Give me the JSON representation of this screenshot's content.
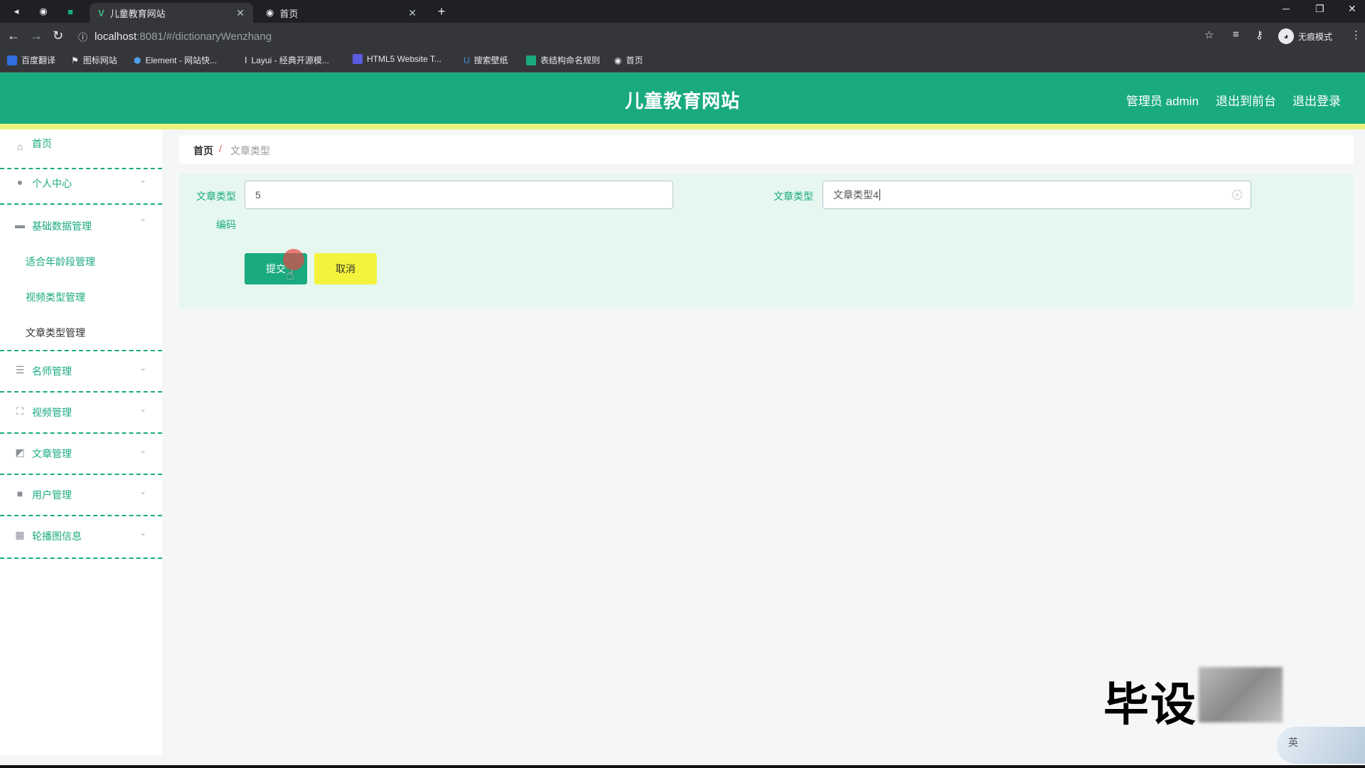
{
  "browser": {
    "tabs": [
      {
        "title": "儿童教育网站",
        "active": true
      },
      {
        "title": "首页",
        "active": false
      }
    ],
    "new_tab": "+",
    "url_host": "localhost",
    "url_path": ":8081/#/dictionaryWenzhang",
    "incognito_label": "无痕模式",
    "bookmarks": [
      {
        "label": "百度翻译",
        "color": "#2f6fe0"
      },
      {
        "label": "图标网站",
        "color": "#ffffff"
      },
      {
        "label": "Element - 网站快...",
        "color": "#4e9fe8"
      },
      {
        "label": "Layui - 经典开源模...",
        "color": "#cccccc"
      },
      {
        "label": "HTML5 Website T...",
        "color": "#5b5be0"
      },
      {
        "label": "搜索壁纸",
        "color": "#4a90e2"
      },
      {
        "label": "表结构命名规则",
        "color": "#1aaa80"
      },
      {
        "label": "首页",
        "color": "#dddddd"
      }
    ]
  },
  "header": {
    "title": "儿童教育网站",
    "admin_label": "管理员 admin",
    "to_front_label": "退出到前台",
    "logout_label": "退出登录"
  },
  "sidebar": {
    "home": "首页",
    "personal": "个人中心",
    "basic_data": "基础数据管理",
    "basic_sub": [
      "适合年龄段管理",
      "视频类型管理",
      "文章类型管理"
    ],
    "teachers": "名师管理",
    "videos": "视频管理",
    "articles": "文章管理",
    "users": "用户管理",
    "carousel": "轮播图信息"
  },
  "breadcrumb": {
    "home": "首页",
    "sep": "/",
    "current": "文章类型"
  },
  "form": {
    "code_label_line1": "文章类型",
    "code_label_line2": "编码",
    "code_value": "5",
    "name_label": "文章类型",
    "name_value": "文章类型4",
    "submit_label": "提交",
    "cancel_label": "取消"
  },
  "overlay": {
    "watermark": "毕设",
    "ime_label": "英"
  },
  "colors": {
    "brand": "#1aaa80",
    "header_strip": "#e9f27a",
    "cancel_button": "#f4f33b"
  }
}
